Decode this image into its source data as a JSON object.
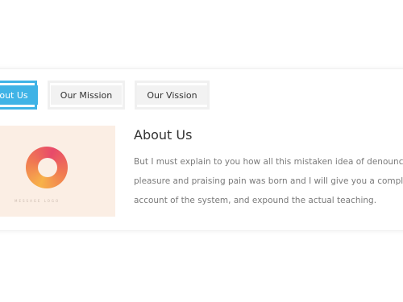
{
  "tabs": {
    "about": "out Us",
    "mission": "Our Mission",
    "vission": "Our Vission"
  },
  "content": {
    "heading": "About Us",
    "lines": [
      "But I must explain to you how all this mistaken idea of denouncing",
      "pleasure and praising pain was born and I will give you a comple",
      "account of the system, and expound the actual teaching."
    ]
  },
  "image": {
    "logo_text": "MESSAGE LOGO"
  },
  "colors": {
    "accent": "#3fb3e6",
    "image_bg": "#fbeee4",
    "logo_orange": "#f7b24a",
    "logo_pink": "#e84a6a"
  }
}
